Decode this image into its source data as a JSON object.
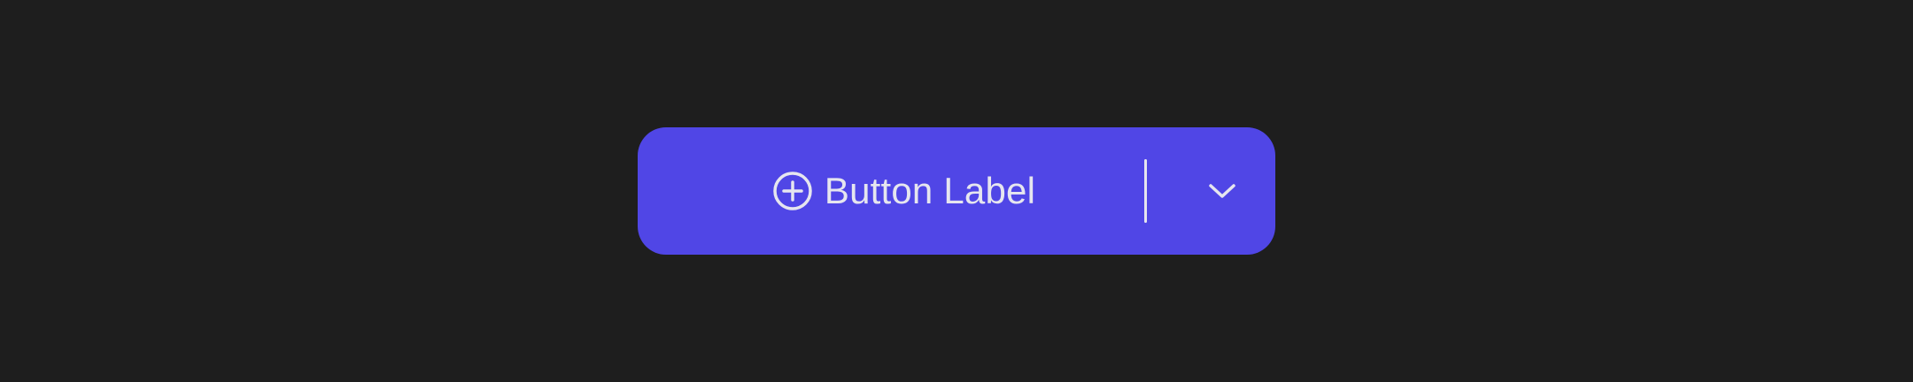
{
  "button": {
    "label": "Button Label",
    "leading_icon": "plus-circle-icon",
    "trailing_icon": "chevron-down-icon",
    "background_color": "#5046e6",
    "foreground_color": "#e6e6ef"
  },
  "page": {
    "background_color": "#1e1e1e"
  }
}
